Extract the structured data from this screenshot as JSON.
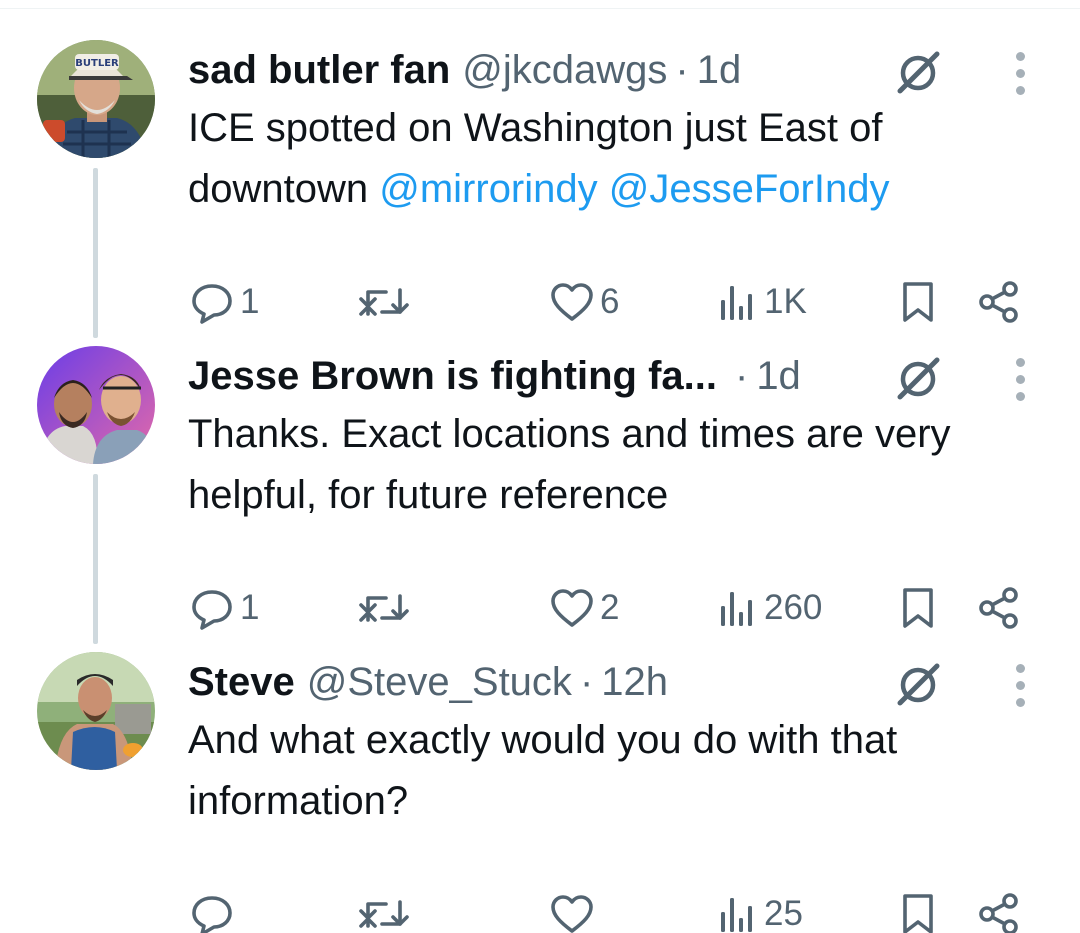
{
  "tweets": [
    {
      "name": "sad butler fan",
      "handle": "@jkcdawgs",
      "separator": "·",
      "time": "1d",
      "text_plain": "ICE spotted on Washington just East of downtown ",
      "mention_1": "@mirrorindy",
      "mention_2": "@JesseForIndy",
      "replies": "1",
      "reposts": "",
      "likes": "6",
      "views": "1K",
      "avatar_hat_text": "BUTLER"
    },
    {
      "name": "Jesse Brown is fighting fa...",
      "separator": "·",
      "time": "1d",
      "text_plain": "Thanks. Exact locations and times are very helpful, for future reference",
      "replies": "1",
      "reposts": "",
      "likes": "2",
      "views": "260"
    },
    {
      "name": "Steve",
      "handle": "@Steve_Stuck",
      "separator": "·",
      "time": "12h",
      "text_plain": "And what exactly would you do with that information?",
      "replies": "",
      "reposts": "",
      "likes": "",
      "views": "25"
    }
  ],
  "icons": {
    "reply": "reply-icon",
    "repost": "repost-icon",
    "like": "heart-icon",
    "views": "views-icon",
    "bookmark": "bookmark-icon",
    "share": "share-icon",
    "grok": "grok-icon",
    "more": "more-vertical-icon"
  },
  "colors": {
    "text": "#0f1419",
    "secondary": "#536471",
    "mention": "#1d9bf0",
    "thread_line": "#cfd9de"
  }
}
